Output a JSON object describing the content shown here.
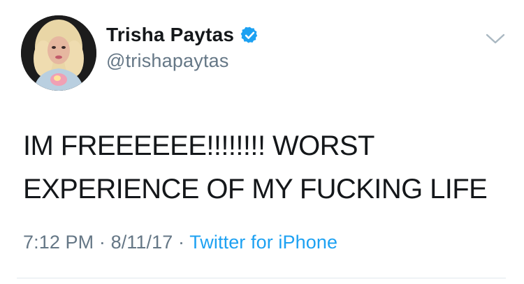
{
  "tweet": {
    "author": {
      "display_name": "Trisha Paytas",
      "handle": "@trishapaytas",
      "verified": true,
      "avatar_icon": "profile-photo"
    },
    "text": "IM FREEEEEE!!!!!!!! WORST\nEXPERIENCE OF MY FUCKING LIFE",
    "time": "7:12 PM",
    "date": "8/11/17",
    "separator": "·",
    "source": "Twitter for iPhone"
  },
  "colors": {
    "primary_text": "#14171a",
    "secondary_text": "#657786",
    "link": "#1da1f2",
    "verified_badge": "#1da1f2",
    "divider": "#e1e8ed"
  },
  "icons": {
    "verified": "verified-badge-icon",
    "menu": "chevron-down-icon"
  }
}
